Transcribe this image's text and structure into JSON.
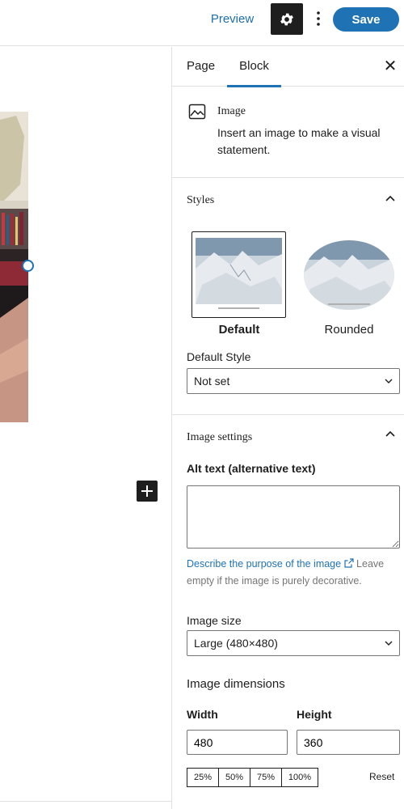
{
  "topbar": {
    "preview_label": "Preview",
    "settings_icon": "gear-icon",
    "more_icon": "vertical-ellipsis-icon",
    "save_label": "Save"
  },
  "canvas": {
    "add_block_icon": "plus-icon"
  },
  "sidebar": {
    "tabs": [
      {
        "label": "Page"
      },
      {
        "label": "Block",
        "active": true
      }
    ],
    "close_icon": "close-icon",
    "block": {
      "name": "Image",
      "description": "Insert an image to make a visual statement.",
      "icon": "image-icon"
    },
    "styles": {
      "title": "Styles",
      "options": [
        {
          "label": "Default",
          "selected": true
        },
        {
          "label": "Rounded",
          "selected": false
        }
      ],
      "default_style_label": "Default Style",
      "default_style_value": "Not set"
    },
    "image_settings": {
      "title": "Image settings",
      "alt_label": "Alt text (alternative text)",
      "alt_value": "",
      "help_link": "Describe the purpose of the image",
      "help_text": " Leave empty if the image is purely decorative.",
      "size_label": "Image size",
      "size_value": "Large (480×480)",
      "dimensions_label": "Image dimensions",
      "width_label": "Width",
      "width_value": "480",
      "height_label": "Height",
      "height_value": "360",
      "percent_options": [
        "25%",
        "50%",
        "75%",
        "100%"
      ],
      "reset_label": "Reset"
    }
  },
  "colors": {
    "accent": "#1f72b4",
    "dark": "#1e1e1e",
    "border": "#e0e0e0"
  }
}
